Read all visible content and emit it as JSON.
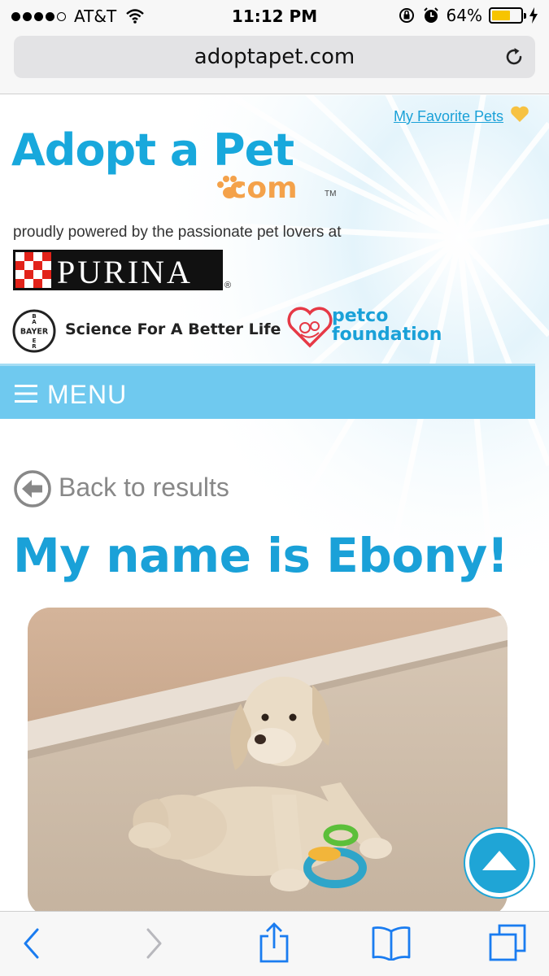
{
  "status_bar": {
    "carrier": "AT&T",
    "time": "11:12 PM",
    "battery_percent": "64%",
    "battery_level": 0.64,
    "signal_bars_filled": 4,
    "signal_bars_total": 5
  },
  "browser": {
    "url": "adoptapet.com",
    "icons": [
      "reload-icon",
      "back-icon",
      "forward-icon",
      "share-icon",
      "bookmarks-icon",
      "tabs-icon"
    ]
  },
  "header": {
    "favorites_link": "My Favorite Pets",
    "logo_main": "Adopt a Pet",
    "logo_dotcom": "com",
    "logo_tm": "TM",
    "powered_by": "proudly powered by the passionate pet lovers at",
    "purina_label": "PURINA",
    "bayer_wordmark": "BAYER",
    "bayer_slogan": "Science For A Better Life",
    "petco_line1": "petco",
    "petco_line2": "foundation"
  },
  "menu": {
    "label": "MENU"
  },
  "pet": {
    "back_label": "Back to results",
    "heading": "My name is Ebony!"
  },
  "colors": {
    "brand_blue": "#1aa1d8",
    "menu_blue": "#6fc9ef",
    "brand_orange": "#f4a24a",
    "favorite_heart": "#f7c242",
    "purina_red": "#e2231a"
  }
}
